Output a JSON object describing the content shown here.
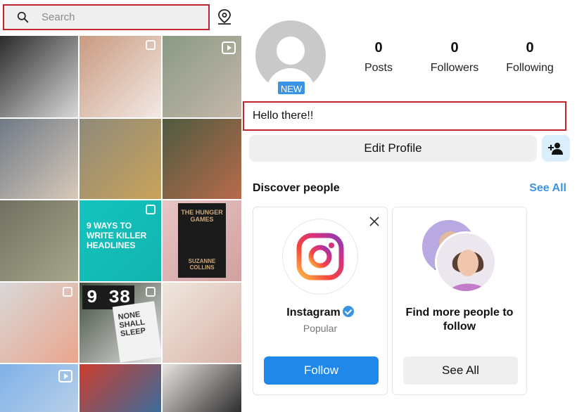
{
  "search": {
    "placeholder": "Search"
  },
  "explore": {
    "tiles": [
      {
        "kind": "photo-person-dark",
        "color_a": "#2b2b2b",
        "color_b": "#d8d8d8"
      },
      {
        "kind": "photo-portrait",
        "color_a": "#c99a80",
        "color_b": "#f2e9e4"
      },
      {
        "kind": "photo-succulents",
        "color_a": "#8a9a84",
        "color_b": "#c5b7aa"
      },
      {
        "kind": "photo-group",
        "color_a": "#6f7a86",
        "color_b": "#d8c9b9"
      },
      {
        "kind": "photo-books-pile",
        "color_a": "#8f8a7a",
        "color_b": "#c9a35a"
      },
      {
        "kind": "photo-plants",
        "color_a": "#4e5b3f",
        "color_b": "#b86a4b"
      },
      {
        "kind": "photo-man-vest",
        "color_a": "#6f7060",
        "color_b": "#a7a68c"
      },
      {
        "kind": "post-headlines",
        "color_a": "#14c4bf",
        "color_b": "#12b4ae",
        "text": "9 WAYS TO WRITE KILLER HEADLINES"
      },
      {
        "kind": "photo-book-cover",
        "color_a": "#e9c5c5",
        "color_b": "#d1a0a0",
        "title": "THE HUNGER GAMES",
        "author": "SUZANNE COLLINS"
      },
      {
        "kind": "photo-laptop",
        "color_a": "#d8d8d8",
        "color_b": "#eaa58d"
      },
      {
        "kind": "photo-clock-book",
        "color_a": "#3d4a3a",
        "color_b": "#e7e7e7",
        "clock": "9 38",
        "book": "NONE SHALL SLEEP"
      },
      {
        "kind": "photo-planner",
        "color_a": "#efe7de",
        "color_b": "#d9b3a8"
      },
      {
        "kind": "reel-blue",
        "color_a": "#7fb1e8",
        "color_b": "#b8cfe8"
      },
      {
        "kind": "photo-buttons",
        "color_a": "#cc3d2e",
        "color_b": "#3a6c9b"
      },
      {
        "kind": "photo-bookshelf",
        "color_a": "#e9e4e0",
        "color_b": "#2c2c2c"
      }
    ]
  },
  "profile": {
    "badge": "NEW",
    "stats": [
      {
        "num": "0",
        "label": "Posts"
      },
      {
        "num": "0",
        "label": "Followers"
      },
      {
        "num": "0",
        "label": "Following"
      }
    ],
    "bio": "Hello there!!",
    "edit_label": "Edit Profile"
  },
  "discover": {
    "title": "Discover people",
    "see_all": "See All",
    "card1": {
      "name": "Instagram",
      "subtitle": "Popular",
      "button": "Follow"
    },
    "card2": {
      "title": "Find more people to follow",
      "button": "See All"
    }
  },
  "colors": {
    "accent": "#1f88e8",
    "link": "#3b93e4",
    "highlight": "#c0262e"
  }
}
